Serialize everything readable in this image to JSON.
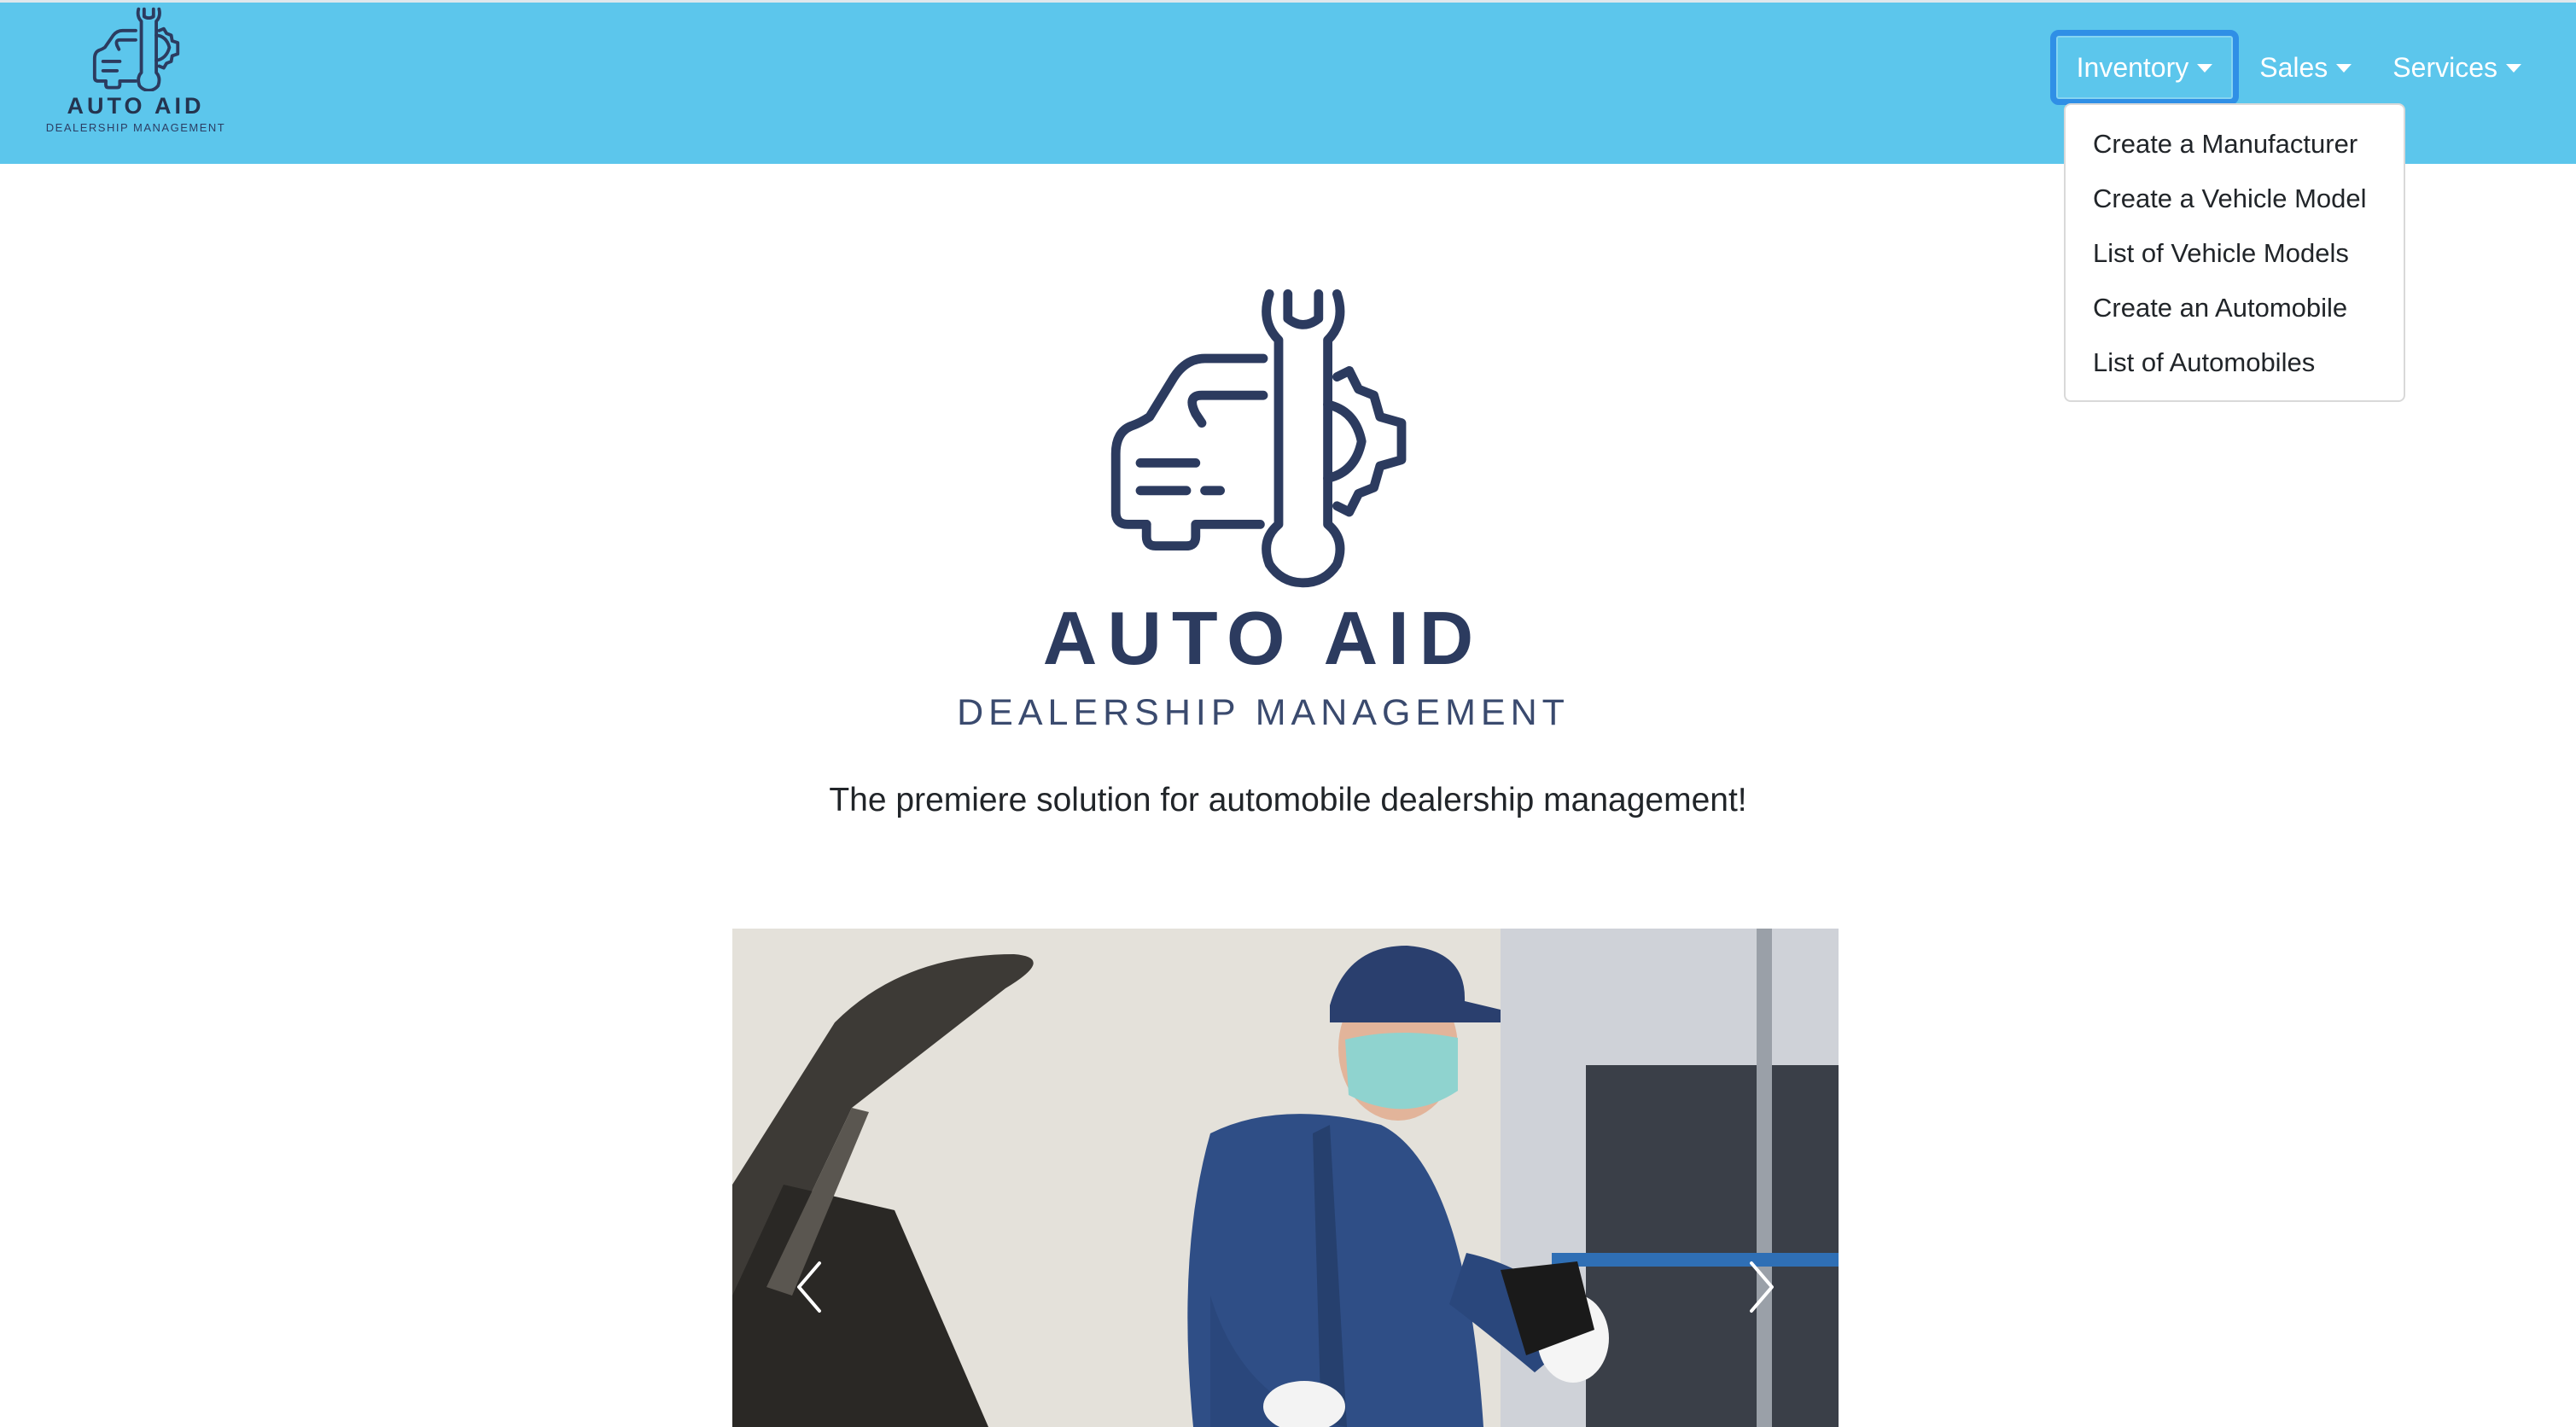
{
  "brand": {
    "title": "AUTO AID",
    "subtitle": "DEALERSHIP MANAGEMENT",
    "logo_icon": "car-wrench-gear-icon"
  },
  "nav": {
    "items": [
      {
        "label": "Inventory",
        "active": true
      },
      {
        "label": "Sales",
        "active": false
      },
      {
        "label": "Services",
        "active": false
      }
    ]
  },
  "dropdown": {
    "items": [
      {
        "label": "Create a Manufacturer"
      },
      {
        "label": "Create a Vehicle Model"
      },
      {
        "label": "List of Vehicle Models"
      },
      {
        "label": "Create an Automobile"
      },
      {
        "label": "List of Automobiles"
      }
    ]
  },
  "hero": {
    "title": "AUTO AID",
    "subtitle": "DEALERSHIP MANAGEMENT",
    "tagline": "The premiere solution for automobile dealership management!"
  },
  "carousel": {
    "prev_icon": "chevron-left-icon",
    "next_icon": "chevron-right-icon"
  },
  "colors": {
    "navbar": "#5cc6ec",
    "brand_navy": "#2c3b5f",
    "active_border": "#2f8fe6"
  }
}
